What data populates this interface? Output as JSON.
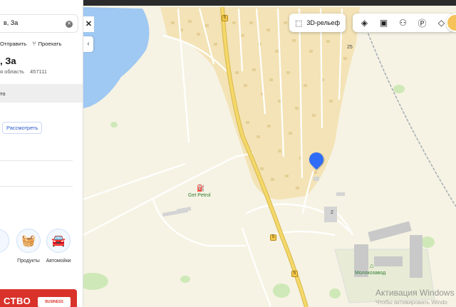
{
  "search": {
    "value": "в, За"
  },
  "actions": {
    "send_label": "Отправить",
    "route_label": "Проехать"
  },
  "place": {
    "title": ", За",
    "region": "я область",
    "postal_code": "457111"
  },
  "panel": {
    "band_text": "то",
    "view_button": "Рассмотреть"
  },
  "categories": [
    {
      "label": "Продукты",
      "icon": "basket-icon"
    },
    {
      "label": "Автомойки",
      "icon": "car-wash-icon"
    }
  ],
  "ad": {
    "text": "СТВО",
    "logo": "BUSINESS"
  },
  "toolbar": {
    "relief_label": "3D-рельеф",
    "buttons": [
      "traffic-light-icon",
      "bus-icon",
      "people-icon",
      "parking-icon",
      "layers-icon"
    ]
  },
  "map": {
    "poi_gas": "Get Petrol",
    "poi_factory": "Молокозавод",
    "house_numbers": [
      "25",
      "2"
    ],
    "road_shield": "5",
    "colors": {
      "land": "#f6f3e4",
      "settlement": "#f3e3b6",
      "water": "#9fc8f2",
      "road_main": "#f3d86a",
      "pin": "#2f6df6"
    }
  },
  "watermark": {
    "title": "Активация Windows",
    "subtitle": "Чтобы активировать Windo"
  }
}
